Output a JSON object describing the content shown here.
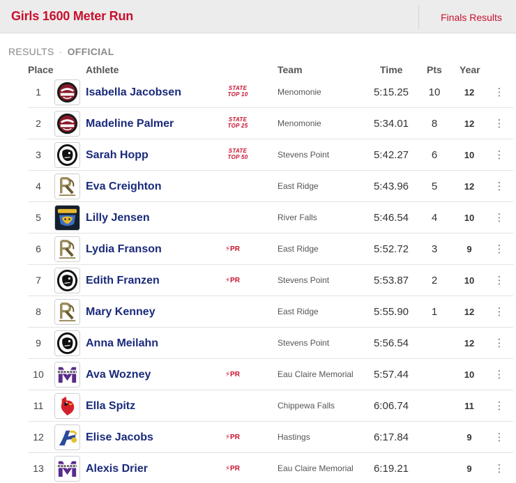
{
  "header": {
    "title": "Girls 1600 Meter Run",
    "finals_label": "Finals Results"
  },
  "status": {
    "label": "RESULTS",
    "separator": "·",
    "official": "OFFICIAL"
  },
  "columns": {
    "place": "Place",
    "athlete": "Athlete",
    "team": "Team",
    "time": "Time",
    "pts": "Pts",
    "year": "Year"
  },
  "colors": {
    "accent": "#c8102e",
    "athlete_link": "#1a2a7a"
  },
  "results": [
    {
      "place": "1",
      "athlete": "Isabella Jacobsen",
      "badge": "state",
      "badge_line1": "STATE",
      "badge_line2": "TOP 10",
      "team": "Menomonie",
      "logo": "mustang-logo",
      "time": "5:15.25",
      "pts": "10",
      "year": "12"
    },
    {
      "place": "2",
      "athlete": "Madeline Palmer",
      "badge": "state",
      "badge_line1": "STATE",
      "badge_line2": "TOP 25",
      "team": "Menomonie",
      "logo": "mustang-logo",
      "time": "5:34.01",
      "pts": "8",
      "year": "12"
    },
    {
      "place": "3",
      "athlete": "Sarah Hopp",
      "badge": "state",
      "badge_line1": "STATE",
      "badge_line2": "TOP 50",
      "team": "Stevens Point",
      "logo": "panther-logo",
      "time": "5:42.27",
      "pts": "6",
      "year": "10"
    },
    {
      "place": "4",
      "athlete": "Eva Creighton",
      "badge": "",
      "team": "East Ridge",
      "logo": "raptor-logo",
      "time": "5:43.96",
      "pts": "5",
      "year": "12"
    },
    {
      "place": "5",
      "athlete": "Lilly Jensen",
      "badge": "",
      "team": "River Falls",
      "logo": "wildcat-logo",
      "time": "5:46.54",
      "pts": "4",
      "year": "10"
    },
    {
      "place": "6",
      "athlete": "Lydia Franson",
      "badge": "pr",
      "badge_text": "PR",
      "team": "East Ridge",
      "logo": "raptor-logo",
      "time": "5:52.72",
      "pts": "3",
      "year": "9"
    },
    {
      "place": "7",
      "athlete": "Edith Franzen",
      "badge": "pr",
      "badge_text": "PR",
      "team": "Stevens Point",
      "logo": "panther-logo",
      "time": "5:53.87",
      "pts": "2",
      "year": "10"
    },
    {
      "place": "8",
      "athlete": "Mary Kenney",
      "badge": "",
      "team": "East Ridge",
      "logo": "raptor-logo",
      "time": "5:55.90",
      "pts": "1",
      "year": "12"
    },
    {
      "place": "9",
      "athlete": "Anna Meilahn",
      "badge": "",
      "team": "Stevens Point",
      "logo": "panther-logo",
      "time": "5:56.54",
      "pts": "",
      "year": "12"
    },
    {
      "place": "10",
      "athlete": "Ava Wozney",
      "badge": "pr",
      "badge_text": "PR",
      "team": "Eau Claire Memorial",
      "logo": "old-abes-logo",
      "time": "5:57.44",
      "pts": "",
      "year": "10"
    },
    {
      "place": "11",
      "athlete": "Ella Spitz",
      "badge": "",
      "team": "Chippewa Falls",
      "logo": "cardinal-logo",
      "time": "6:06.74",
      "pts": "",
      "year": "11"
    },
    {
      "place": "12",
      "athlete": "Elise Jacobs",
      "badge": "pr",
      "badge_text": "PR",
      "team": "Hastings",
      "logo": "raider-logo",
      "time": "6:17.84",
      "pts": "",
      "year": "9"
    },
    {
      "place": "13",
      "athlete": "Alexis Drier",
      "badge": "pr",
      "badge_text": "PR",
      "team": "Eau Claire Memorial",
      "logo": "old-abes-logo",
      "time": "6:19.21",
      "pts": "",
      "year": "9"
    }
  ]
}
